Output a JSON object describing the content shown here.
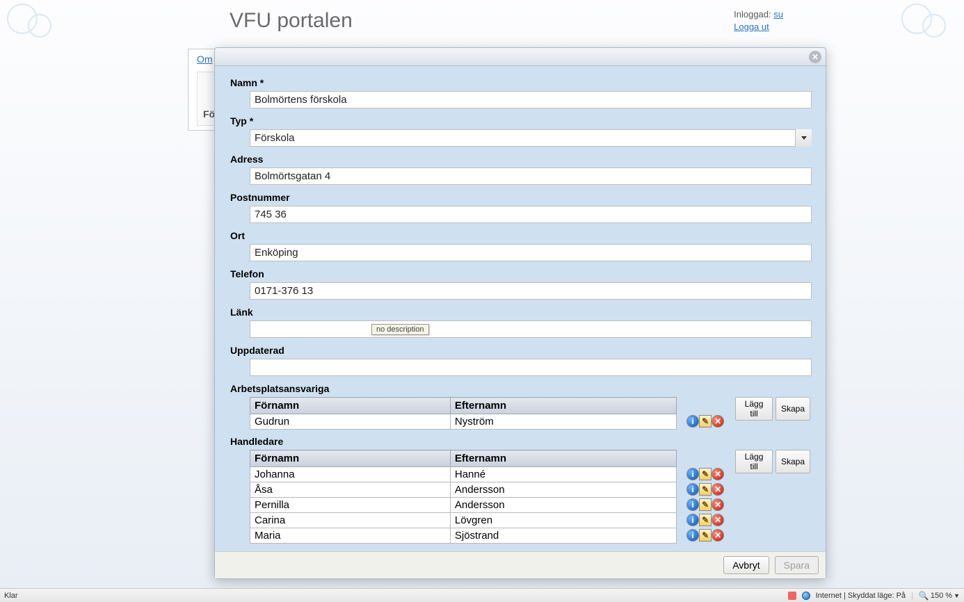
{
  "header": {
    "title": "VFU portalen",
    "logged_in_label": "Inloggad:",
    "user_link": "su",
    "logout": "Logga ut"
  },
  "background_tab": "Om",
  "background_section": "Fö",
  "dialog": {
    "close_glyph": "✕",
    "fields": {
      "name_label": "Namn *",
      "name_value": "Bolmörtens förskola",
      "type_label": "Typ *",
      "type_value": "Förskola",
      "address_label": "Adress",
      "address_value": "Bolmörtsgatan 4",
      "postal_label": "Postnummer",
      "postal_value": "745 36",
      "city_label": "Ort",
      "city_value": "Enköping",
      "phone_label": "Telefon",
      "phone_value": "0171-376 13",
      "link_label": "Länk",
      "link_value": "",
      "updated_label": "Uppdaterad",
      "updated_value": ""
    },
    "tooltip": "no description",
    "tables": {
      "col_first": "Förnamn",
      "col_last": "Efternamn",
      "add_btn": "Lägg till",
      "create_btn": "Skapa",
      "managers_title": "Arbetsplatsansvariga",
      "managers": [
        {
          "first": "Gudrun",
          "last": "Nyström"
        }
      ],
      "supervisors_title": "Handledare",
      "supervisors": [
        {
          "first": "Johanna",
          "last": "Hanné"
        },
        {
          "first": "Åsa",
          "last": "Andersson"
        },
        {
          "first": "Pernilla",
          "last": "Andersson"
        },
        {
          "first": "Carina",
          "last": "Lövgren"
        },
        {
          "first": "Maria",
          "last": "Sjöstrand"
        }
      ]
    },
    "footer": {
      "cancel": "Avbryt",
      "save": "Spara"
    }
  },
  "statusbar": {
    "left": "Klar",
    "zone": "Internet | Skyddat läge: På",
    "zoom": "150 %"
  }
}
